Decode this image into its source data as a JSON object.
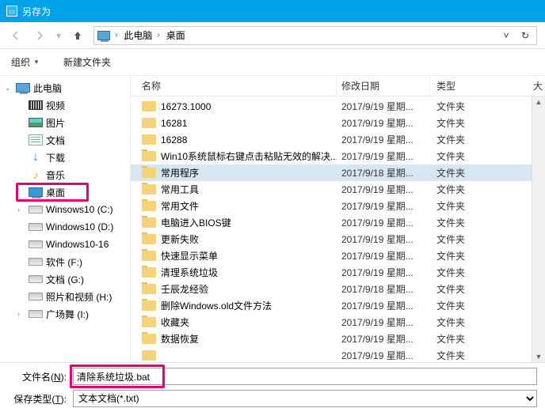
{
  "window": {
    "title": "另存为"
  },
  "nav": {
    "address_root_icon": "pc-icon",
    "path": [
      "此电脑",
      "桌面"
    ]
  },
  "toolbar": {
    "organize": "组织",
    "new_folder": "新建文件夹"
  },
  "sidebar": {
    "root": "此电脑",
    "items": [
      {
        "label": "视频",
        "icon": "film"
      },
      {
        "label": "图片",
        "icon": "pic"
      },
      {
        "label": "文档",
        "icon": "doc"
      },
      {
        "label": "下载",
        "icon": "dl",
        "glyph": "↓"
      },
      {
        "label": "音乐",
        "icon": "music",
        "glyph": "♪"
      },
      {
        "label": "桌面",
        "icon": "desk",
        "highlight": true
      },
      {
        "label": "Winsows10 (C:)",
        "icon": "disk",
        "caret": true
      },
      {
        "label": "Windows10  (D:)",
        "icon": "disk"
      },
      {
        "label": "Windows10-16",
        "icon": "disk"
      },
      {
        "label": "软件 (F:)",
        "icon": "disk"
      },
      {
        "label": "文档 (G:)",
        "icon": "disk"
      },
      {
        "label": "照片和视频 (H:)",
        "icon": "disk"
      },
      {
        "label": "广场舞 (I:)",
        "icon": "disk",
        "caret": true
      }
    ]
  },
  "columns": {
    "name": "名称",
    "date": "修改日期",
    "type": "类型",
    "size": "大"
  },
  "files": [
    {
      "name": "16273.1000",
      "date": "2017/9/19 星期...",
      "type": "文件夹"
    },
    {
      "name": "16281",
      "date": "2017/9/19 星期...",
      "type": "文件夹"
    },
    {
      "name": "16288",
      "date": "2017/9/19 星期...",
      "type": "文件夹"
    },
    {
      "name": "Win10系统鼠标右键点击粘贴无效的解决...",
      "date": "2017/9/19 星期...",
      "type": "文件夹"
    },
    {
      "name": "常用程序",
      "date": "2017/9/18 星期...",
      "type": "文件夹",
      "selected": true
    },
    {
      "name": "常用工具",
      "date": "2017/9/19 星期...",
      "type": "文件夹"
    },
    {
      "name": "常用文件",
      "date": "2017/9/19 星期...",
      "type": "文件夹"
    },
    {
      "name": "电脑进入BIOS键",
      "date": "2017/9/19 星期...",
      "type": "文件夹"
    },
    {
      "name": "更新失败",
      "date": "2017/9/19 星期...",
      "type": "文件夹"
    },
    {
      "name": "快速显示菜单",
      "date": "2017/9/19 星期...",
      "type": "文件夹"
    },
    {
      "name": "清理系统垃圾",
      "date": "2017/9/19 星期...",
      "type": "文件夹"
    },
    {
      "name": "壬辰龙经验",
      "date": "2017/9/18 星期...",
      "type": "文件夹"
    },
    {
      "name": "删除Windows.old文件方法",
      "date": "2017/9/19 星期...",
      "type": "文件夹"
    },
    {
      "name": "收藏夹",
      "date": "2017/9/19 星期...",
      "type": "文件夹"
    },
    {
      "name": "数据恢复",
      "date": "2017/9/19 星期...",
      "type": "文件夹"
    },
    {
      "name": "",
      "date": "2017/9/19 星期...",
      "type": "文件夹"
    }
  ],
  "footer": {
    "filename_label_pre": "文件名(",
    "filename_label_u": "N",
    "filename_label_post": "):",
    "filename_value": "清除系统垃圾.bat",
    "type_label_pre": "保存类型(",
    "type_label_u": "T",
    "type_label_post": "):",
    "type_value": "文本文档(*.txt)"
  }
}
